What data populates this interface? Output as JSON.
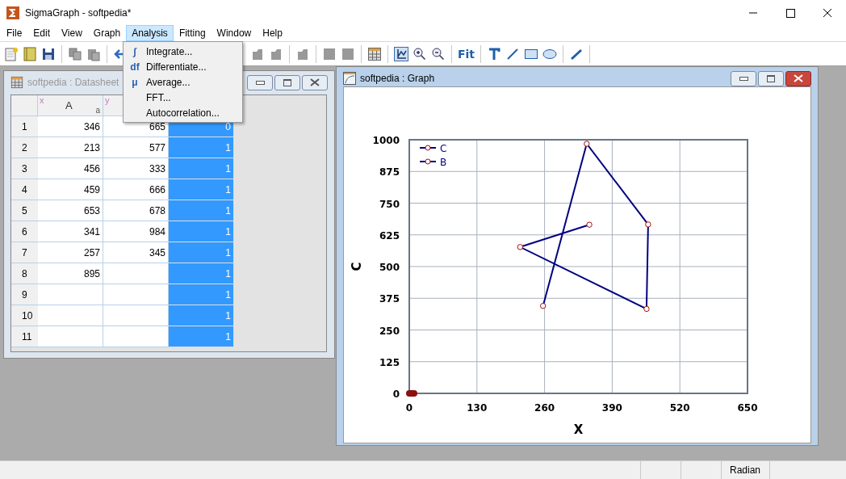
{
  "app": {
    "title": "SigmaGraph - softpedia*"
  },
  "menu": [
    {
      "label": "File",
      "selected": false
    },
    {
      "label": "Edit",
      "selected": false
    },
    {
      "label": "View",
      "selected": false
    },
    {
      "label": "Graph",
      "selected": false
    },
    {
      "label": "Analysis",
      "selected": true
    },
    {
      "label": "Fitting",
      "selected": false
    },
    {
      "label": "Window",
      "selected": false
    },
    {
      "label": "Help",
      "selected": false
    }
  ],
  "analysis_menu": [
    {
      "icon": "∫",
      "label": "Integrate..."
    },
    {
      "icon": "df",
      "label": "Differentiate..."
    },
    {
      "icon": "μ",
      "label": "Average..."
    },
    {
      "label": "FFT..."
    },
    {
      "label": "Autocorrelation..."
    }
  ],
  "toolbar": {
    "fit_label": "Fit"
  },
  "datasheet": {
    "title": "softpedia : Datasheet",
    "active": false,
    "columns": [
      {
        "tag": "x",
        "name": "A",
        "sub": "a",
        "selected": false
      },
      {
        "tag": "y",
        "selected": false
      },
      {
        "selected": true
      }
    ],
    "rows": [
      {
        "num": "1",
        "cells": [
          "346",
          "665",
          "0"
        ]
      },
      {
        "num": "2",
        "cells": [
          "213",
          "577",
          "1"
        ]
      },
      {
        "num": "3",
        "cells": [
          "456",
          "333",
          "1"
        ]
      },
      {
        "num": "4",
        "cells": [
          "459",
          "666",
          "1"
        ]
      },
      {
        "num": "5",
        "cells": [
          "653",
          "678",
          "1"
        ]
      },
      {
        "num": "6",
        "cells": [
          "341",
          "984",
          "1"
        ]
      },
      {
        "num": "7",
        "cells": [
          "257",
          "345",
          "1"
        ]
      },
      {
        "num": "8",
        "cells": [
          "895",
          null,
          "1"
        ]
      },
      {
        "num": "9",
        "cells": [
          null,
          null,
          "1"
        ]
      },
      {
        "num": "10",
        "cells": [
          null,
          null,
          "1"
        ]
      },
      {
        "num": "11",
        "cells": [
          null,
          null,
          "1"
        ]
      }
    ]
  },
  "graph": {
    "title": "softpedia : Graph",
    "active": true,
    "chart_data": {
      "type": "line",
      "xlabel": "X",
      "ylabel": "C",
      "x": [
        346,
        213,
        456,
        459,
        341,
        257
      ],
      "series": [
        {
          "name": "C",
          "color": "#000080",
          "marker": "circle",
          "values": [
            665,
            577,
            333,
            666,
            984,
            345
          ]
        },
        {
          "name": "B",
          "color": "#000080",
          "marker": "circle",
          "values": [
            null,
            null,
            null,
            null,
            null,
            null
          ]
        }
      ],
      "grid": true,
      "xlim": [
        0,
        650
      ],
      "ylim": [
        0,
        1000
      ],
      "xticks": [
        0,
        130,
        260,
        390,
        520,
        650
      ],
      "yticks": [
        0,
        125,
        250,
        375,
        500,
        625,
        750,
        875,
        1000
      ]
    }
  },
  "status_bar": {
    "mode": "Radian"
  }
}
